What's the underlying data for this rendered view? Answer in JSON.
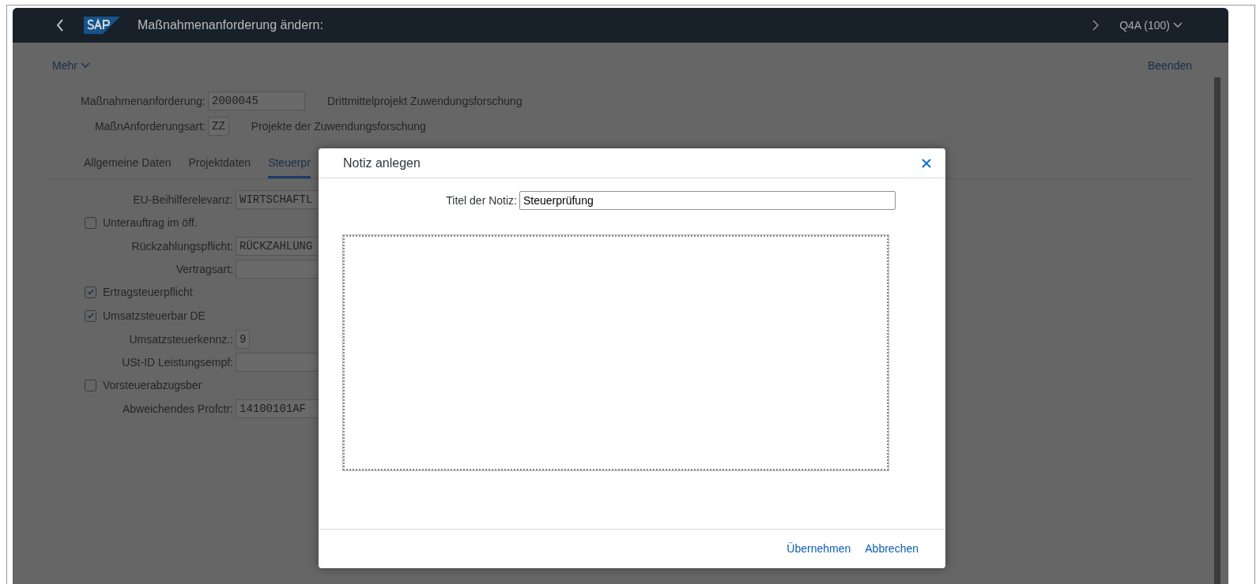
{
  "shell": {
    "title": "Maßnahmenanforderung ändern:",
    "system": "Q4A (100)"
  },
  "toolbar": {
    "more": "Mehr",
    "exit": "Beenden"
  },
  "header_fields": [
    {
      "kind": "field",
      "label": "Maßnahmenanforderung:",
      "value": "2000045",
      "description": "Drittmittelprojekt Zuwendungsforschung"
    },
    {
      "kind": "short_field",
      "label": "MaßnAnforderungsart:",
      "value": "ZZ",
      "description": "Projekte der Zuwendungsforschung"
    }
  ],
  "tabs": [
    {
      "label": "Allgemeine Daten",
      "selected": false
    },
    {
      "label": "Projektdaten",
      "selected": false
    },
    {
      "label": "Steuerpr",
      "selected": true
    }
  ],
  "form": [
    {
      "kind": "field",
      "label": "EU-Beihilferelevanz:",
      "value": "WIRTSCHAFTL"
    },
    {
      "kind": "checkbox",
      "label": "Unterauftrag im öff.",
      "checked": false
    },
    {
      "kind": "field",
      "label": "Rückzahlungspflicht:",
      "value": "RÜCKZAHLUNG"
    },
    {
      "kind": "field",
      "label": "Vertragsart:"
    },
    {
      "kind": "checkbox",
      "label": "Ertragsteuerpflicht",
      "checked": true
    },
    {
      "kind": "checkbox",
      "label": "Umsatzsteuerbar DE",
      "checked": true
    },
    {
      "kind": "short_field",
      "label": "Umsatzsteuerkennz.:",
      "value": "9"
    },
    {
      "kind": "field",
      "label": "USt-ID Leistungsempf:"
    },
    {
      "kind": "checkbox",
      "label": "Vorsteuerabzugsber",
      "checked": false
    },
    {
      "kind": "field",
      "label": "Abweichendes Profctr:",
      "value": "14100101AF"
    }
  ],
  "dialog": {
    "title": "Notiz anlegen",
    "title_label": "Titel der Notiz:",
    "title_value": "Steuerprüfung",
    "buttons": [
      "Übernehmen",
      "Abbrechen"
    ]
  }
}
